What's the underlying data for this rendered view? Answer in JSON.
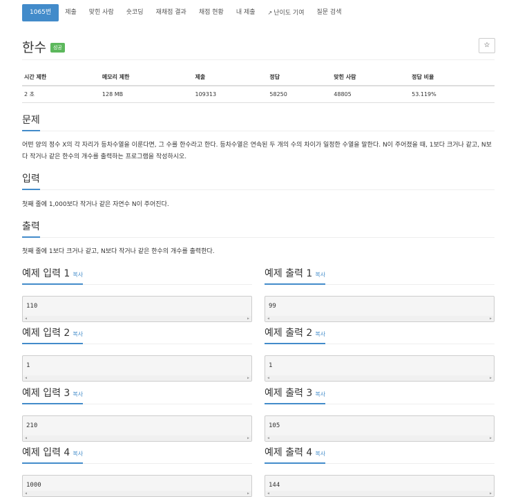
{
  "tabs": [
    "1065번",
    "제출",
    "맞힌 사람",
    "숏코딩",
    "재채점 결과",
    "채점 현황",
    "내 제출",
    "난이도 기여",
    "질문 검색"
  ],
  "problem": {
    "title": "한수",
    "badge": "성공",
    "star": "☆"
  },
  "stats": {
    "headers": [
      "시간 제한",
      "메모리 제한",
      "제출",
      "정답",
      "맞힌 사람",
      "정답 비율"
    ],
    "values": [
      "2 초",
      "128 MB",
      "109313",
      "58250",
      "48805",
      "53.119%"
    ]
  },
  "sections": {
    "problem": {
      "title": "문제",
      "text": "어떤 양의 정수 X의 각 자리가 등차수열을 이룬다면, 그 수를 한수라고 한다. 등차수열은 연속된 두 개의 수의 차이가 일정한 수열을 말한다. N이 주어졌을 때, 1보다 크거나 같고, N보다 작거나 같은 한수의 개수를 출력하는 프로그램을 작성하시오."
    },
    "input": {
      "title": "입력",
      "text": "첫째 줄에 1,000보다 작거나 같은 자연수 N이 주어진다."
    },
    "output": {
      "title": "출력",
      "text": "첫째 줄에 1보다 크거나 같고, N보다 작거나 같은 한수의 개수를 출력한다."
    }
  },
  "copy_label": "복사",
  "examples": [
    {
      "in_title": "예제 입력 1",
      "in": "110",
      "out_title": "예제 출력 1",
      "out": "99"
    },
    {
      "in_title": "예제 입력 2",
      "in": "1",
      "out_title": "예제 출력 2",
      "out": "1"
    },
    {
      "in_title": "예제 입력 3",
      "in": "210",
      "out_title": "예제 출력 3",
      "out": "105"
    },
    {
      "in_title": "예제 입력 4",
      "in": "1000",
      "out_title": "예제 출력 4",
      "out": "144"
    }
  ]
}
